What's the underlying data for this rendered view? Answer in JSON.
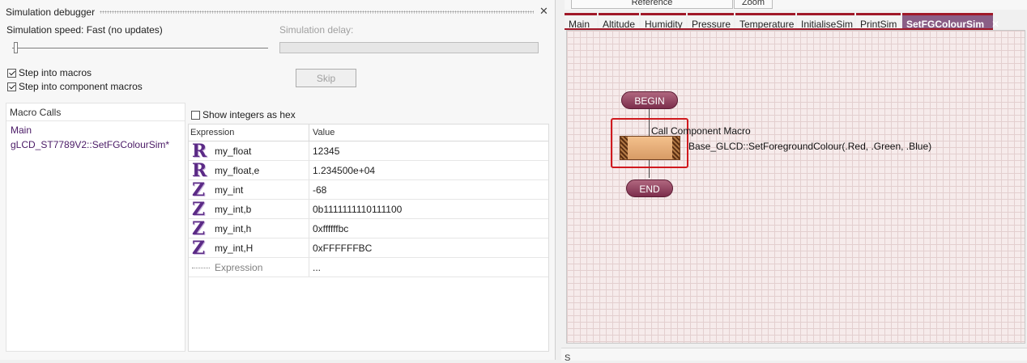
{
  "debugger": {
    "title": "Simulation debugger",
    "close_glyph": "✕",
    "speed_label": "Simulation speed: Fast (no updates)",
    "delay_label": "Simulation delay:",
    "step_macros": {
      "label": "Step into macros",
      "checked": true
    },
    "step_component": {
      "label": "Step into component macros",
      "checked": true
    },
    "skip_label": "Skip",
    "macro_calls": {
      "header": "Macro Calls",
      "items": [
        "Main",
        "gLCD_ST7789V2::SetFGColourSim*"
      ]
    },
    "show_hex": {
      "label": "Show integers as hex",
      "checked": false
    },
    "table": {
      "headers": [
        "Expression",
        "Value"
      ],
      "rows": [
        {
          "type": "R",
          "name": "my_float",
          "value": "12345"
        },
        {
          "type": "R",
          "name": "my_float,e",
          "value": "1.234500e+04"
        },
        {
          "type": "Z",
          "name": "my_int",
          "value": "-68"
        },
        {
          "type": "Z",
          "name": "my_int,b",
          "value": "0b1111111110111100"
        },
        {
          "type": "Z",
          "name": "my_int,h",
          "value": "0xffffffbc"
        },
        {
          "type": "Z",
          "name": "my_int,H",
          "value": "0xFFFFFFBC"
        }
      ],
      "new_row": {
        "name": "Expression",
        "value": "..."
      }
    }
  },
  "top_tabs": [
    "Reference",
    "Zoom"
  ],
  "tabs": [
    {
      "label": "Main",
      "active": false
    },
    {
      "label": "Altitude",
      "active": false
    },
    {
      "label": "Humidity",
      "active": false
    },
    {
      "label": "Pressure",
      "active": false
    },
    {
      "label": "Temperature",
      "active": false
    },
    {
      "label": "InitialiseSim",
      "active": false
    },
    {
      "label": "PrintSim",
      "active": false
    },
    {
      "label": "SetFGColourSim",
      "active": true
    }
  ],
  "tab_close_glyph": "✕",
  "flowchart": {
    "begin": "BEGIN",
    "end": "END",
    "call_label": "Call Component Macro",
    "call_text": "Base_GLCD::SetForegroundColour(.Red, .Green, .Blue)"
  },
  "bottom_text": "S",
  "colors": {
    "tab_accent": "#a01828",
    "active_tab": "#8a5e86",
    "selection": "#d0191e",
    "terminal": "#8a3a5a",
    "macro_text": "#4a1a66"
  }
}
